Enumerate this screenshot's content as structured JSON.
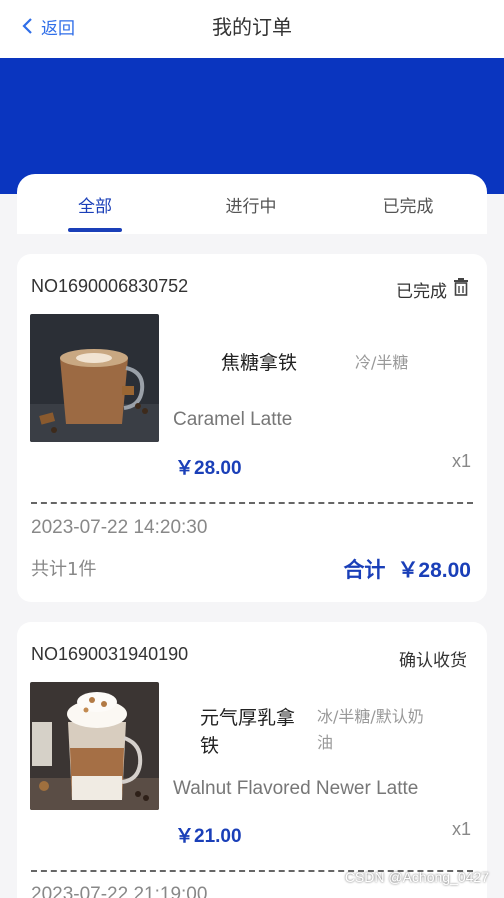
{
  "nav": {
    "back_label": "返回",
    "title": "我的订单"
  },
  "colors": {
    "brand_blue": "#0a35bf",
    "accent_blue": "#1a3fb8",
    "link_blue": "#2f6ee8"
  },
  "tabs": [
    {
      "label": "全部",
      "active": true
    },
    {
      "label": "进行中",
      "active": false
    },
    {
      "label": "已完成",
      "active": false
    }
  ],
  "orders": [
    {
      "order_no": "NO1690006830752",
      "status": "已完成",
      "status_icon": "trash-icon",
      "item": {
        "name": "焦糖拿铁",
        "spec": "冷/半糖",
        "en_name": "Caramel Latte",
        "price": "￥28.00",
        "qty": "x1"
      },
      "time": "2023-07-22 14:20:30",
      "count": "共计1件",
      "total_label": "合计",
      "total_value": "￥28.00"
    },
    {
      "order_no": "NO1690031940190",
      "status": "确认收货",
      "item": {
        "name": "元气厚乳拿铁",
        "spec": "冰/半糖/默认奶油",
        "en_name": "Walnut Flavored Newer Latte",
        "price": "￥21.00",
        "qty": "x1"
      },
      "time": "2023-07-22 21:19:00"
    }
  ],
  "watermark": "CSDN @Achong_0427"
}
